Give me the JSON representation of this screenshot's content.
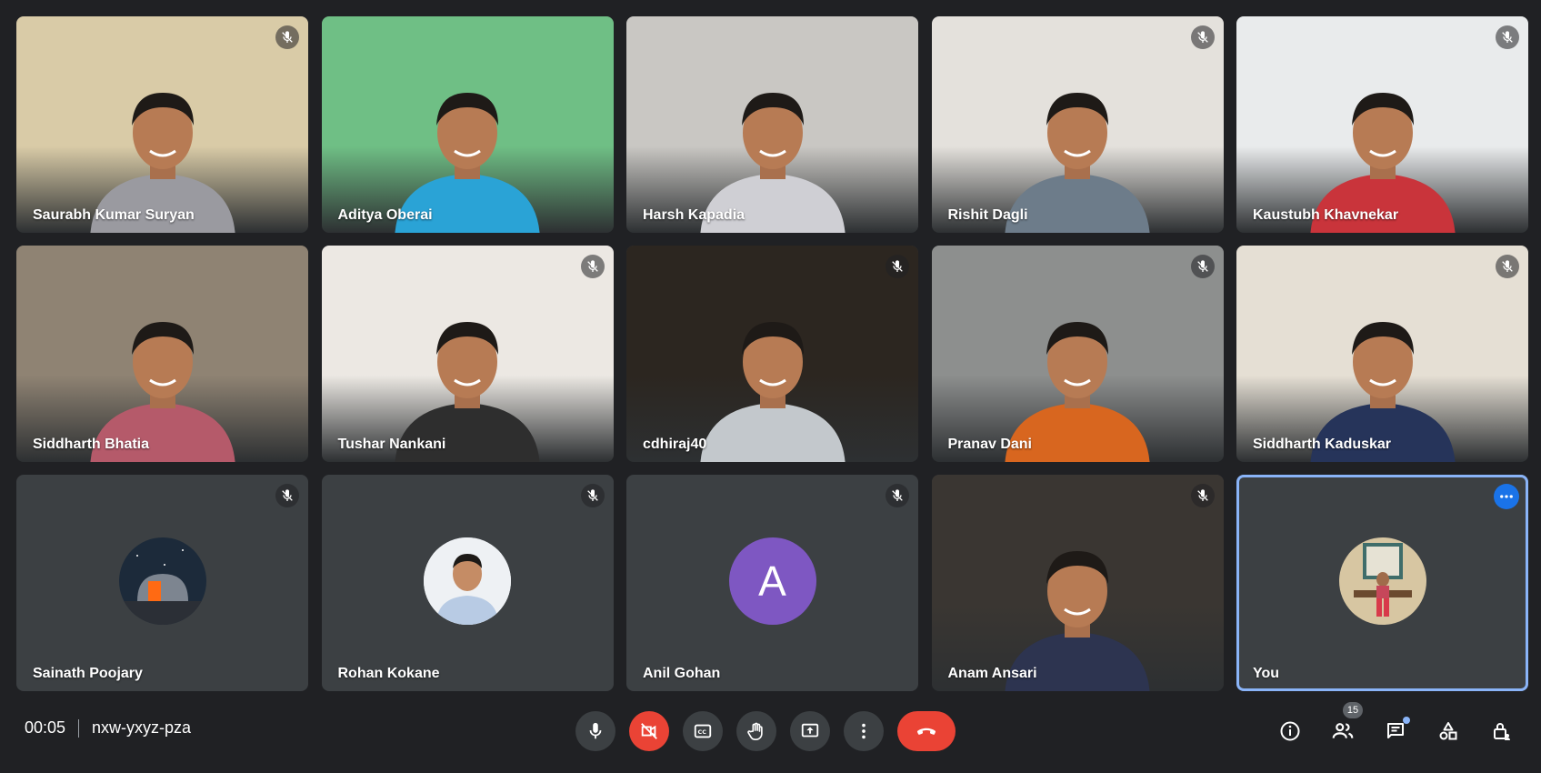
{
  "participants": [
    {
      "name": "Saurabh Kumar Suryan",
      "muted": true,
      "video": true,
      "bg": "#d9cba7",
      "shirt": "#9a9aa0"
    },
    {
      "name": "Aditya Oberai",
      "muted": false,
      "video": true,
      "bg": "#6fbf85",
      "shirt": "#2aa3d6"
    },
    {
      "name": "Harsh Kapadia",
      "muted": false,
      "video": true,
      "bg": "#c9c7c3",
      "shirt": "#cfcfd4"
    },
    {
      "name": "Rishit Dagli",
      "muted": true,
      "video": true,
      "bg": "#e4e1dc",
      "shirt": "#6d7c8a"
    },
    {
      "name": "Kaustubh Khavnekar",
      "muted": true,
      "video": true,
      "bg": "#e9ebec",
      "shirt": "#c9343b"
    },
    {
      "name": "Siddharth Bhatia",
      "muted": false,
      "video": true,
      "bg": "#8f8373",
      "shirt": "#b55a6a"
    },
    {
      "name": "Tushar Nankani",
      "muted": true,
      "video": true,
      "bg": "#ece8e3",
      "shirt": "#2e2e2e"
    },
    {
      "name": "cdhiraj40",
      "muted": true,
      "video": true,
      "bg": "#2c2620",
      "shirt": "#c3c8cc"
    },
    {
      "name": "Pranav Dani",
      "muted": true,
      "video": true,
      "bg": "#8d8f8e",
      "shirt": "#d8661f"
    },
    {
      "name": "Siddharth Kaduskar",
      "muted": true,
      "video": true,
      "bg": "#e5dfd4",
      "shirt": "#26345a"
    },
    {
      "name": "Sainath Poojary",
      "muted": true,
      "video": false,
      "avatar": "observatory"
    },
    {
      "name": "Rohan Kokane",
      "muted": true,
      "video": false,
      "avatar": "photo"
    },
    {
      "name": "Anil Gohan",
      "muted": true,
      "video": false,
      "avatar": "letter",
      "letter": "A"
    },
    {
      "name": "Anam Ansari",
      "muted": true,
      "video": true,
      "bg": "#3a3632",
      "shirt": "#2d3450"
    },
    {
      "name": "You",
      "muted": false,
      "video": false,
      "avatar": "photo-self",
      "self": true
    }
  ],
  "meeting": {
    "time": "00:05",
    "code": "nxw-yxyz-pza"
  },
  "controls": {
    "mic": "microphone-icon",
    "camera": "camera-off-icon",
    "captions": "captions-icon",
    "raise_hand": "hand-icon",
    "present": "present-screen-icon",
    "more": "more-options-icon",
    "end_call": "end-call-icon"
  },
  "side_panel": {
    "people_count": "15"
  },
  "colors": {
    "background": "#202124",
    "tile": "#3c4043",
    "accent": "#8ab4f8",
    "danger": "#ea4335"
  }
}
